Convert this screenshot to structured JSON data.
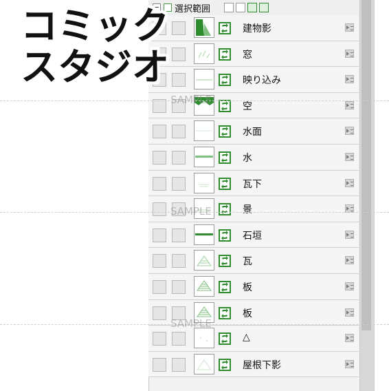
{
  "overlay": {
    "title": "コミック\nスタジオ"
  },
  "watermark": {
    "text": "SAMPLE"
  },
  "panel": {
    "header_title": "選択範囲"
  },
  "layers": [
    {
      "name": "建物影",
      "thumb": "building-shadow"
    },
    {
      "name": "窓",
      "thumb": "window"
    },
    {
      "name": "映り込み",
      "thumb": "reflection"
    },
    {
      "name": "空",
      "thumb": "sky"
    },
    {
      "name": "水面",
      "thumb": "water-surface"
    },
    {
      "name": "水",
      "thumb": "water"
    },
    {
      "name": "瓦下",
      "thumb": "under-tile"
    },
    {
      "name": "景",
      "thumb": "scenery"
    },
    {
      "name": "石垣",
      "thumb": "stone-wall"
    },
    {
      "name": "瓦",
      "thumb": "tile"
    },
    {
      "name": "板",
      "thumb": "board"
    },
    {
      "name": "板",
      "thumb": "board"
    },
    {
      "name": "△",
      "thumb": "triangle"
    },
    {
      "name": "屋根下影",
      "thumb": "roof-shadow"
    }
  ],
  "colors": {
    "accent_green": "#2e8b2e",
    "panel_bg": "#f3f3f3"
  }
}
